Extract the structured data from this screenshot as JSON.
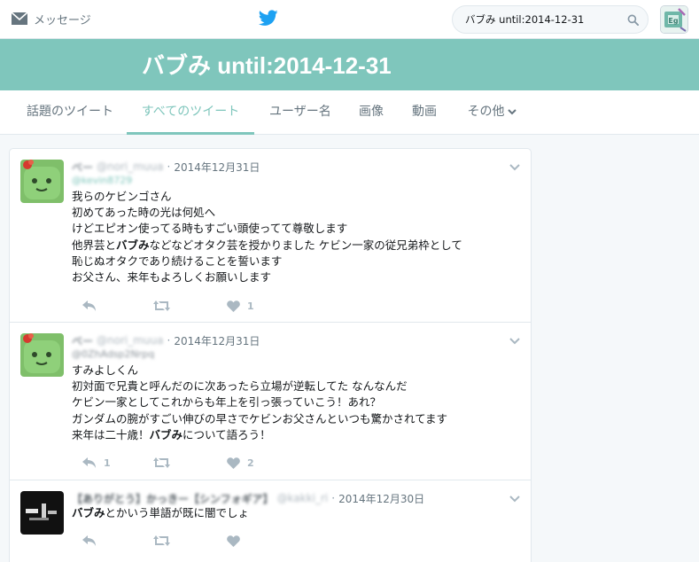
{
  "topbar": {
    "messages_label": "メッセージ",
    "search_value": "バブみ until:2014-12-31",
    "accent": "#7fc6bc",
    "bird_color": "#1da1f2"
  },
  "banner": {
    "title": "バブみ until:2014-12-31"
  },
  "tabs": [
    {
      "label": "話題のツイート",
      "active": false
    },
    {
      "label": "すべてのツイート",
      "active": true
    },
    {
      "label": "ユーザー名",
      "active": false
    },
    {
      "label": "画像",
      "active": false
    },
    {
      "label": "動画",
      "active": false
    },
    {
      "label": "その他",
      "active": false
    }
  ],
  "tweets": [
    {
      "name": "ベー",
      "handle": "@nori_muua",
      "date": "2014年12月31日",
      "reply_to": "@kevin8729",
      "lines": [
        "我らのケビンゴさん",
        "初めてあった時の光は何処へ",
        "けどエピオン使ってる時もすごい頭使ってて尊敬します",
        "他界芸とバブみなどなどオタク芸を授かりました ケビン一家の従兄弟枠として",
        "恥じぬオタクであり続けることを誓います",
        "お父さん、来年もよろしくお願いします"
      ],
      "reply_count": "",
      "retweet_count": "",
      "like_count": "1"
    },
    {
      "name": "ベー",
      "handle": "@nori_muua",
      "date": "2014年12月31日",
      "reply_to": "@0ZhAdsp2Nrpq",
      "lines": [
        "すみよしくん",
        "初対面で兄貴と呼んだのに次あったら立場が逆転してた なんなんだ",
        "ケビン一家としてこれからも年上を引っ張っていこう！あれ？",
        "ガンダムの腕がすごい伸びの早さでケビンお父さんといつも驚かされてます",
        "来年は二十歳！バブみについて語ろう！"
      ],
      "reply_count": "1",
      "retweet_count": "",
      "like_count": "2"
    },
    {
      "name": "【ありがとう】かっきー【シンフォギア】",
      "handle": "@kakki_ri",
      "date": "2014年12月30日",
      "reply_to": "",
      "lines": [
        "バブみとかいう単語が既に闇でしょ"
      ],
      "reply_count": "",
      "retweet_count": "",
      "like_count": ""
    }
  ]
}
